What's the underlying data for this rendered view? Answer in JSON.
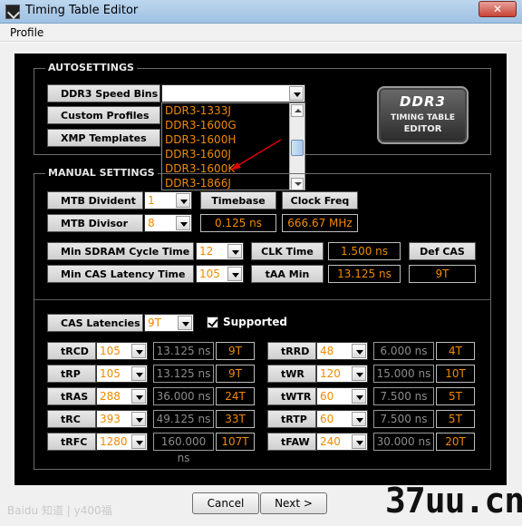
{
  "window": {
    "title": "Timing Table Editor",
    "close_label": "✕"
  },
  "menu": {
    "items": [
      "Profile"
    ]
  },
  "autosettings": {
    "title": "AUTOSETTINGS",
    "speed_bins_label": "DDR3 Speed Bins",
    "speed_bins_value": "",
    "custom_profiles_label": "Custom Profiles",
    "xmp_templates_label": "XMP Templates",
    "dropdown_items": [
      "DDR3-1333J",
      "DDR3-1600G",
      "DDR3-1600H",
      "DDR3-1600J",
      "DDR3-1600K",
      "DDR3-1866J"
    ],
    "highlighted_item": "DDR3-1600K"
  },
  "logo": {
    "top": "DDR3",
    "mid": "TIMING TABLE",
    "bot": "EDITOR"
  },
  "manual": {
    "title": "MANUAL SETTINGS",
    "mtb_divident_label": "MTB Divident",
    "mtb_divident_value": "1",
    "mtb_divisor_label": "MTB Divisor",
    "mtb_divisor_value": "8",
    "timebase_label": "Timebase",
    "timebase_value": "0.125 ns",
    "clock_freq_label": "Clock Freq",
    "clock_freq_value": "666.67 MHz",
    "min_sdram_label": "Min SDRAM Cycle Time",
    "min_sdram_value": "12",
    "clk_time_label": "CLK Time",
    "clk_time_value": "1.500 ns",
    "def_cas_label": "Def CAS",
    "min_cas_label": "Min CAS Latency Time",
    "min_cas_value": "105",
    "taa_min_label": "tAA Min",
    "taa_min_value": "13.125 ns",
    "def_cas_value": "9T"
  },
  "cas": {
    "label": "CAS Latencies",
    "value": "9T",
    "supported_label": "Supported",
    "supported_checked": true
  },
  "timings_left": [
    {
      "name": "tRCD",
      "value": "105",
      "ns": "13.125 ns",
      "t": "9T"
    },
    {
      "name": "tRP",
      "value": "105",
      "ns": "13.125 ns",
      "t": "9T"
    },
    {
      "name": "tRAS",
      "value": "288",
      "ns": "36.000 ns",
      "t": "24T"
    },
    {
      "name": "tRC",
      "value": "393",
      "ns": "49.125 ns",
      "t": "33T"
    },
    {
      "name": "tRFC",
      "value": "1280",
      "ns": "160.000 ns",
      "t": "107T"
    }
  ],
  "timings_right": [
    {
      "name": "tRRD",
      "value": "48",
      "ns": "6.000 ns",
      "t": "4T"
    },
    {
      "name": "tWR",
      "value": "120",
      "ns": "15.000 ns",
      "t": "10T"
    },
    {
      "name": "tWTR",
      "value": "60",
      "ns": "7.500 ns",
      "t": "5T"
    },
    {
      "name": "tRTP",
      "value": "60",
      "ns": "7.500 ns",
      "t": "5T"
    },
    {
      "name": "tFAW",
      "value": "240",
      "ns": "30.000 ns",
      "t": "20T"
    }
  ],
  "buttons": {
    "cancel": "Cancel",
    "next": "Next >"
  },
  "watermarks": {
    "left": "Baidu 知道 | y400福",
    "right": "37uu.cn"
  },
  "colors": {
    "accent": "#f08a00",
    "arrow": "#e00000"
  }
}
